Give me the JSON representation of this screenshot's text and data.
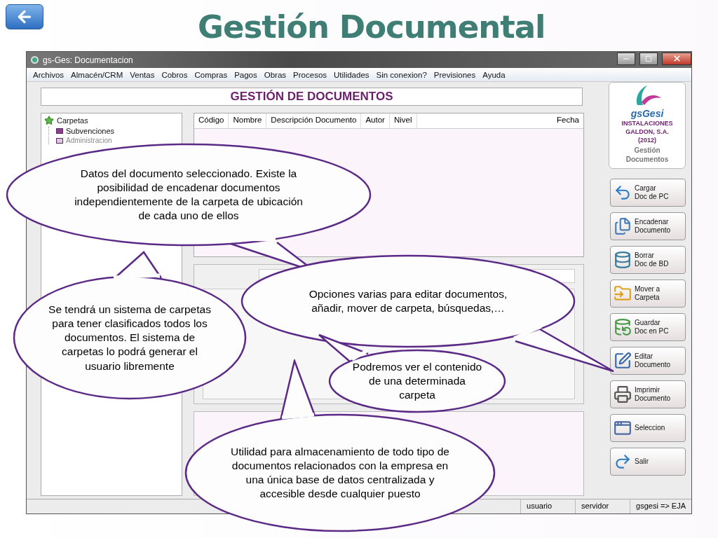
{
  "slide": {
    "title": "Gestión Documental"
  },
  "window": {
    "title": "gs-Ges: Documentacion"
  },
  "menu": [
    "Archivos",
    "Almacén/CRM",
    "Ventas",
    "Cobros",
    "Compras",
    "Pagos",
    "Obras",
    "Procesos",
    "Utilidades",
    "Sin conexion?",
    "Previsiones",
    "Ayuda"
  ],
  "header": "GESTIÓN DE DOCUMENTOS",
  "tree": {
    "label": "Carpetas",
    "children": [
      {
        "label": "Subvenciones",
        "disabled": false
      },
      {
        "label": "Administracion",
        "disabled": true
      }
    ]
  },
  "table": {
    "columns": [
      "Código",
      "Nombre",
      "Descripción Documento",
      "Autor",
      "Nivel",
      "Fecha"
    ]
  },
  "brand": {
    "logo_text": "gsGesi",
    "company": "INSTALACIONES GALDON, S.A. (2012)",
    "module": "Gestión Documentos"
  },
  "actions": [
    {
      "label": "Cargar\nDoc de PC",
      "kind": "upload"
    },
    {
      "label": "Encadenar\nDocumento",
      "kind": "chain"
    },
    {
      "label": "Borrar\nDoc de BD",
      "kind": "delete"
    },
    {
      "label": "Mover a\nCarpeta",
      "kind": "move"
    },
    {
      "label": "Guardar\nDoc en PC",
      "kind": "save"
    },
    {
      "label": "Editar\nDocumento",
      "kind": "edit"
    },
    {
      "label": "Imprimir\nDocumento",
      "kind": "print"
    },
    {
      "label": "Seleccion",
      "kind": "select"
    },
    {
      "label": "Salir",
      "kind": "exit"
    }
  ],
  "status_bar": [
    "usuario",
    "servidor",
    "gsgesi => EJA"
  ],
  "callouts": [
    {
      "text": "Datos del documento seleccionado. Existe la posibilidad de encadenar documentos independientemente de la carpeta de ubicación de cada uno de ellos"
    },
    {
      "text": "Se tendrá un sistema de carpetas para tener clasificados todos los documentos. El sistema de carpetas lo podrá generar el usuario libremente"
    },
    {
      "text": "Opciones varias para editar documentos, añadir, mover de carpeta, búsquedas,…"
    },
    {
      "text": "Podremos ver el contenido de una determinada carpeta"
    },
    {
      "text": "Utilidad para almacenamiento de todo tipo de documentos relacionados con la empresa en una única base de datos centralizada y accesible desde cualquier puesto"
    }
  ]
}
